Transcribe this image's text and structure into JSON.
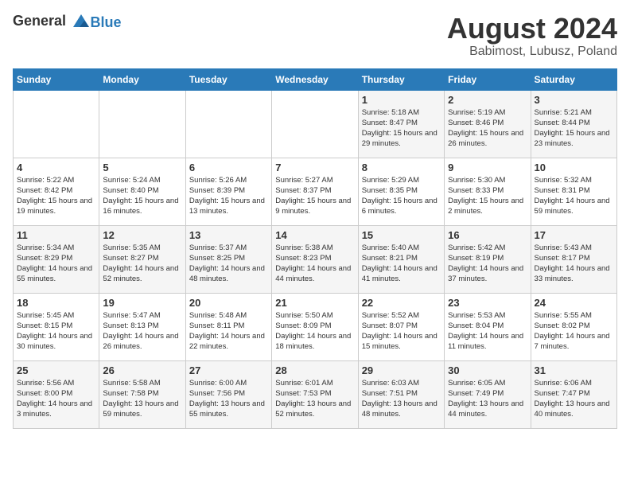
{
  "header": {
    "logo_general": "General",
    "logo_blue": "Blue",
    "title": "August 2024",
    "subtitle": "Babimost, Lubusz, Poland"
  },
  "weekdays": [
    "Sunday",
    "Monday",
    "Tuesday",
    "Wednesday",
    "Thursday",
    "Friday",
    "Saturday"
  ],
  "weeks": [
    [
      {
        "day": "",
        "info": ""
      },
      {
        "day": "",
        "info": ""
      },
      {
        "day": "",
        "info": ""
      },
      {
        "day": "",
        "info": ""
      },
      {
        "day": "1",
        "info": "Sunrise: 5:18 AM\nSunset: 8:47 PM\nDaylight: 15 hours\nand 29 minutes."
      },
      {
        "day": "2",
        "info": "Sunrise: 5:19 AM\nSunset: 8:46 PM\nDaylight: 15 hours\nand 26 minutes."
      },
      {
        "day": "3",
        "info": "Sunrise: 5:21 AM\nSunset: 8:44 PM\nDaylight: 15 hours\nand 23 minutes."
      }
    ],
    [
      {
        "day": "4",
        "info": "Sunrise: 5:22 AM\nSunset: 8:42 PM\nDaylight: 15 hours\nand 19 minutes."
      },
      {
        "day": "5",
        "info": "Sunrise: 5:24 AM\nSunset: 8:40 PM\nDaylight: 15 hours\nand 16 minutes."
      },
      {
        "day": "6",
        "info": "Sunrise: 5:26 AM\nSunset: 8:39 PM\nDaylight: 15 hours\nand 13 minutes."
      },
      {
        "day": "7",
        "info": "Sunrise: 5:27 AM\nSunset: 8:37 PM\nDaylight: 15 hours\nand 9 minutes."
      },
      {
        "day": "8",
        "info": "Sunrise: 5:29 AM\nSunset: 8:35 PM\nDaylight: 15 hours\nand 6 minutes."
      },
      {
        "day": "9",
        "info": "Sunrise: 5:30 AM\nSunset: 8:33 PM\nDaylight: 15 hours\nand 2 minutes."
      },
      {
        "day": "10",
        "info": "Sunrise: 5:32 AM\nSunset: 8:31 PM\nDaylight: 14 hours\nand 59 minutes."
      }
    ],
    [
      {
        "day": "11",
        "info": "Sunrise: 5:34 AM\nSunset: 8:29 PM\nDaylight: 14 hours\nand 55 minutes."
      },
      {
        "day": "12",
        "info": "Sunrise: 5:35 AM\nSunset: 8:27 PM\nDaylight: 14 hours\nand 52 minutes."
      },
      {
        "day": "13",
        "info": "Sunrise: 5:37 AM\nSunset: 8:25 PM\nDaylight: 14 hours\nand 48 minutes."
      },
      {
        "day": "14",
        "info": "Sunrise: 5:38 AM\nSunset: 8:23 PM\nDaylight: 14 hours\nand 44 minutes."
      },
      {
        "day": "15",
        "info": "Sunrise: 5:40 AM\nSunset: 8:21 PM\nDaylight: 14 hours\nand 41 minutes."
      },
      {
        "day": "16",
        "info": "Sunrise: 5:42 AM\nSunset: 8:19 PM\nDaylight: 14 hours\nand 37 minutes."
      },
      {
        "day": "17",
        "info": "Sunrise: 5:43 AM\nSunset: 8:17 PM\nDaylight: 14 hours\nand 33 minutes."
      }
    ],
    [
      {
        "day": "18",
        "info": "Sunrise: 5:45 AM\nSunset: 8:15 PM\nDaylight: 14 hours\nand 30 minutes."
      },
      {
        "day": "19",
        "info": "Sunrise: 5:47 AM\nSunset: 8:13 PM\nDaylight: 14 hours\nand 26 minutes."
      },
      {
        "day": "20",
        "info": "Sunrise: 5:48 AM\nSunset: 8:11 PM\nDaylight: 14 hours\nand 22 minutes."
      },
      {
        "day": "21",
        "info": "Sunrise: 5:50 AM\nSunset: 8:09 PM\nDaylight: 14 hours\nand 18 minutes."
      },
      {
        "day": "22",
        "info": "Sunrise: 5:52 AM\nSunset: 8:07 PM\nDaylight: 14 hours\nand 15 minutes."
      },
      {
        "day": "23",
        "info": "Sunrise: 5:53 AM\nSunset: 8:04 PM\nDaylight: 14 hours\nand 11 minutes."
      },
      {
        "day": "24",
        "info": "Sunrise: 5:55 AM\nSunset: 8:02 PM\nDaylight: 14 hours\nand 7 minutes."
      }
    ],
    [
      {
        "day": "25",
        "info": "Sunrise: 5:56 AM\nSunset: 8:00 PM\nDaylight: 14 hours\nand 3 minutes."
      },
      {
        "day": "26",
        "info": "Sunrise: 5:58 AM\nSunset: 7:58 PM\nDaylight: 13 hours\nand 59 minutes."
      },
      {
        "day": "27",
        "info": "Sunrise: 6:00 AM\nSunset: 7:56 PM\nDaylight: 13 hours\nand 55 minutes."
      },
      {
        "day": "28",
        "info": "Sunrise: 6:01 AM\nSunset: 7:53 PM\nDaylight: 13 hours\nand 52 minutes."
      },
      {
        "day": "29",
        "info": "Sunrise: 6:03 AM\nSunset: 7:51 PM\nDaylight: 13 hours\nand 48 minutes."
      },
      {
        "day": "30",
        "info": "Sunrise: 6:05 AM\nSunset: 7:49 PM\nDaylight: 13 hours\nand 44 minutes."
      },
      {
        "day": "31",
        "info": "Sunrise: 6:06 AM\nSunset: 7:47 PM\nDaylight: 13 hours\nand 40 minutes."
      }
    ]
  ]
}
